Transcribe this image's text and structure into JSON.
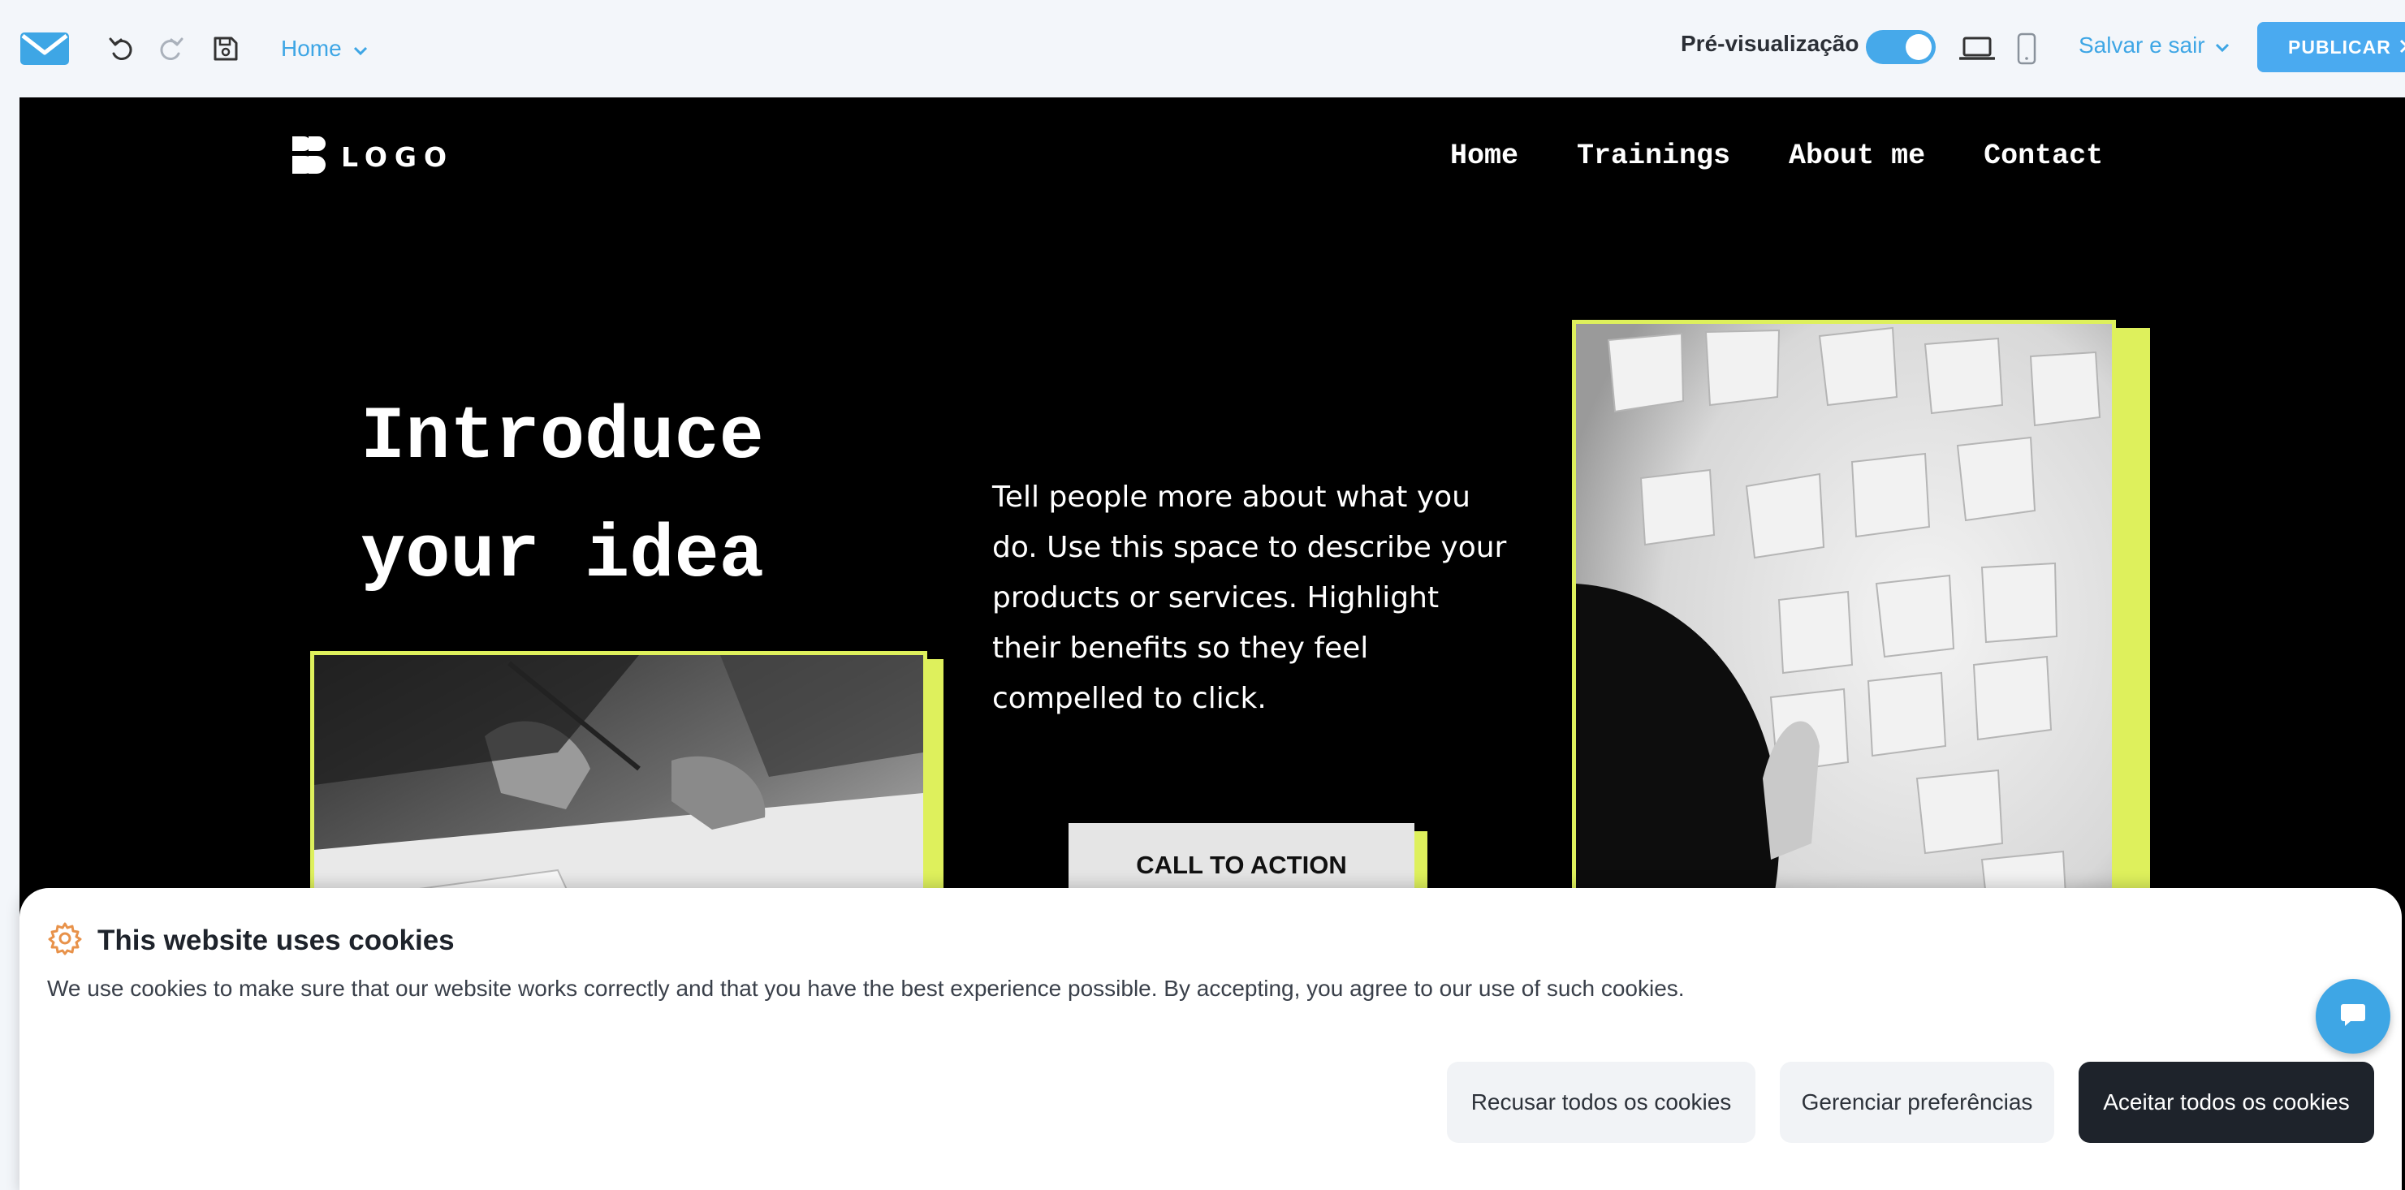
{
  "toolbar": {
    "brand_icon": "mail-envelope-icon",
    "undo_icon": "undo-icon",
    "redo_icon": "redo-icon",
    "save_icon": "save-disk-icon",
    "page_selector": "Home",
    "preview_label": "Pré-visualização",
    "preview_enabled": true,
    "desktop_icon": "laptop-icon",
    "mobile_icon": "mobile-icon",
    "save_exit_label": "Salvar e sair",
    "publish_label": "PUBLICAR",
    "accent_color": "#3ea6e5"
  },
  "site": {
    "logo_text": "LOGO",
    "nav": [
      "Home",
      "Trainings",
      "About me",
      "Contact"
    ],
    "hero_title_line1": "Introduce",
    "hero_title_line2": "your idea",
    "hero_text": "Tell people more about what you do. Use this space to describe your products or services. Highlight their benefits so they feel compelled to click.",
    "cta_label": "CALL TO ACTION",
    "accent_color": "#def05c",
    "images": {
      "left": "hands-drawing-on-paper-photo",
      "right": "sticky-notes-on-wall-photo"
    }
  },
  "cookie_banner": {
    "icon": "gear-icon",
    "title": "This website uses cookies",
    "message": "We use cookies to make sure that our website works correctly and that you have the best experience possible. By accepting, you agree to our use of such cookies.",
    "reject_label": "Recusar todos os cookies",
    "manage_label": "Gerenciar preferências",
    "accept_label": "Aceitar todos os cookies"
  },
  "chat_widget": {
    "icon": "chat-bubble-icon"
  }
}
